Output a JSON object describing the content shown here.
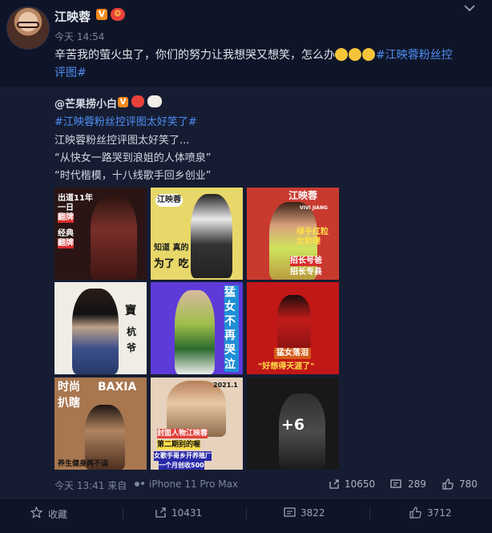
{
  "post": {
    "username": "江映蓉",
    "v_badge": "V",
    "time": "今天 14:54",
    "text_main": "辛苦我的萤火虫了，你们的努力让我想哭又想笑，怎么办",
    "hashtag_line1": "#江映蓉粉丝控",
    "hashtag_line2": "评图#"
  },
  "repost": {
    "author": "@芒果捞小白",
    "v_badge": "V",
    "hashtag": "#江映蓉粉丝控评图太好笑了#",
    "line1": "江映蓉粉丝控评图太好笑了...",
    "line2": "“从快女一路哭到浪姐的人体喷泉”",
    "line3": "“时代楷模，十八线歌手回乡创业”",
    "images": [
      {
        "id": "img-1",
        "texts": [
          "出道11年",
          "一日",
          "翻牌",
          "经典",
          "翻牌"
        ]
      },
      {
        "id": "img-2",
        "texts": [
          "江映蓉",
          "知道 真的",
          "为了 吃"
        ]
      },
      {
        "id": "img-3",
        "texts": [
          "江映蓉",
          "VIVI JIANG",
          "绿手红粒",
          "女助理",
          "招长号爸",
          "招长专县"
        ]
      },
      {
        "id": "img-4",
        "texts": [
          "寶",
          "杭",
          "爷"
        ]
      },
      {
        "id": "img-5",
        "texts": [
          "猛女不再哭泣"
        ]
      },
      {
        "id": "img-6",
        "texts": [
          "猛女落泪",
          "\"好想得天涯了\""
        ]
      },
      {
        "id": "img-7",
        "texts": [
          "时尚",
          "BAXIA",
          "扒瞎",
          "养生健身两不误"
        ]
      },
      {
        "id": "img-8",
        "texts": [
          "2021.1",
          "封面人物江映蓉",
          "第二期别的喔",
          "女歌手哥乡开养殖厂",
          "一个月创收500"
        ]
      },
      {
        "id": "img-9",
        "texts": [
          "+6"
        ]
      }
    ],
    "meta_time": "今天 13:41 来自",
    "meta_device": "iPhone 11 Pro Max",
    "repost_count": "10650",
    "comment_count": "289",
    "like_count": "780"
  },
  "footer": {
    "favorite_label": "收藏",
    "repost_count": "10431",
    "comment_count": "3822",
    "like_count": "3712"
  },
  "colors": {
    "background": "#0f1528",
    "repost_background": "#161d33",
    "link": "#4f8ef5",
    "text": "#e1e4ea",
    "muted": "#7d8599"
  }
}
